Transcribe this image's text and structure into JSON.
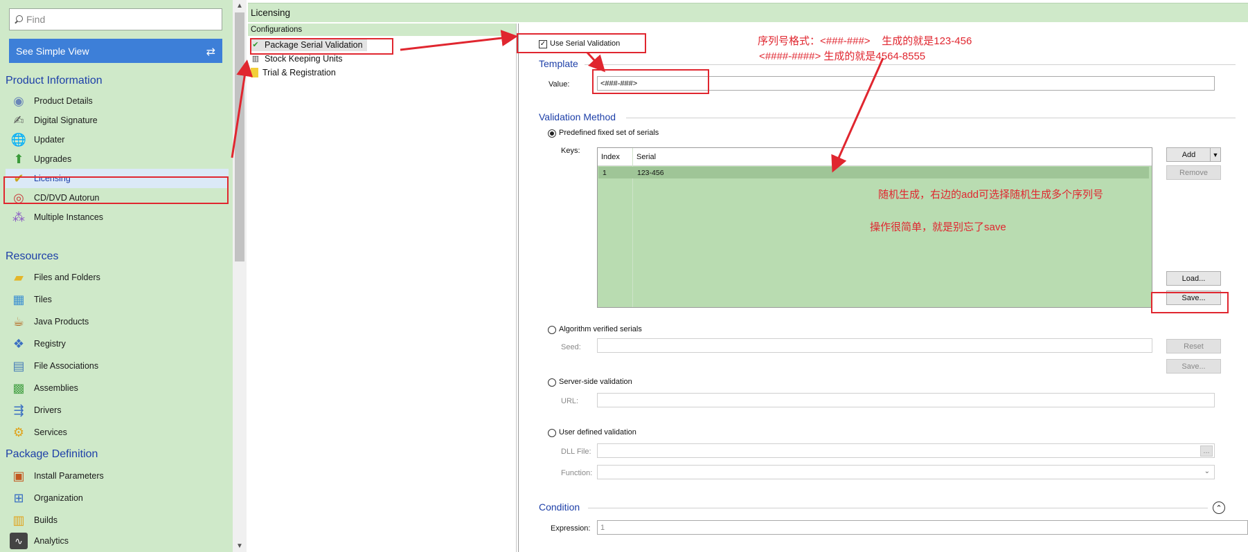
{
  "sidebar": {
    "find_placeholder": "Find",
    "simple_view_label": "See Simple View",
    "sections": {
      "product_information": "Product Information",
      "resources": "Resources",
      "package_definition": "Package Definition"
    },
    "items": [
      {
        "label": "Product Details",
        "icon": "product-details-icon"
      },
      {
        "label": "Digital Signature",
        "icon": "digital-signature-icon"
      },
      {
        "label": "Updater",
        "icon": "updater-icon"
      },
      {
        "label": "Upgrades",
        "icon": "upgrades-icon"
      },
      {
        "label": "Licensing",
        "icon": "licensing-icon",
        "selected": true
      },
      {
        "label": "CD/DVD Autorun",
        "icon": "cd-autorun-icon"
      },
      {
        "label": "Multiple Instances",
        "icon": "multiple-instances-icon"
      },
      {
        "label": "Files and Folders",
        "icon": "folder-icon"
      },
      {
        "label": "Tiles",
        "icon": "tiles-icon"
      },
      {
        "label": "Java Products",
        "icon": "java-icon"
      },
      {
        "label": "Registry",
        "icon": "registry-icon"
      },
      {
        "label": "File Associations",
        "icon": "file-associations-icon"
      },
      {
        "label": "Assemblies",
        "icon": "assemblies-icon"
      },
      {
        "label": "Drivers",
        "icon": "drivers-icon"
      },
      {
        "label": "Services",
        "icon": "services-icon"
      },
      {
        "label": "Install Parameters",
        "icon": "install-parameters-icon"
      },
      {
        "label": "Organization",
        "icon": "organization-icon"
      },
      {
        "label": "Builds",
        "icon": "builds-icon"
      },
      {
        "label": "Analytics",
        "icon": "analytics-icon"
      }
    ]
  },
  "header": {
    "title": "Licensing"
  },
  "tree": {
    "title": "Configurations",
    "items": [
      {
        "label": "Package Serial Validation",
        "selected": true
      },
      {
        "label": "Stock Keeping Units"
      },
      {
        "label": "Trial & Registration"
      }
    ]
  },
  "settings": {
    "use_serial_validation": "Use Serial Validation",
    "template_heading": "Template",
    "value_label": "Value:",
    "value": "<###-###>",
    "validation_heading": "Validation Method",
    "predefined_label": "Predefined fixed set of serials",
    "keys_label": "Keys:",
    "table": {
      "columns": [
        "Index",
        "Serial"
      ],
      "rows": [
        {
          "index": "1",
          "serial": "123-456"
        }
      ]
    },
    "add_button": "Add",
    "remove_button": "Remove",
    "load_button": "Load...",
    "save_button": "Save...",
    "algorithm_label": "Algorithm verified serials",
    "seed_label": "Seed:",
    "reset_button": "Reset",
    "save_button_2": "Save...",
    "server_label": "Server-side validation",
    "url_label": "URL:",
    "user_defined_label": "User defined validation",
    "dll_label": "DLL File:",
    "dll_browse": "...",
    "function_label": "Function:",
    "condition_heading": "Condition",
    "expression_label": "Expression:",
    "expression_value": "1"
  },
  "annotations": {
    "format_line1": "序列号格式：<###-###>    生成的就是123-456",
    "format_line2": "<####-####> 生成的就是4564-8555",
    "random_note": "随机生成，右边的add可选择随机生成多个序列号",
    "save_note": "操作很简单，就是别忘了save"
  },
  "colors": {
    "sidebar_bg": "#cfe9c9",
    "accent_blue": "#3d7fd8",
    "heading_blue": "#1d3fa8",
    "annotation_red": "#e0262f"
  }
}
